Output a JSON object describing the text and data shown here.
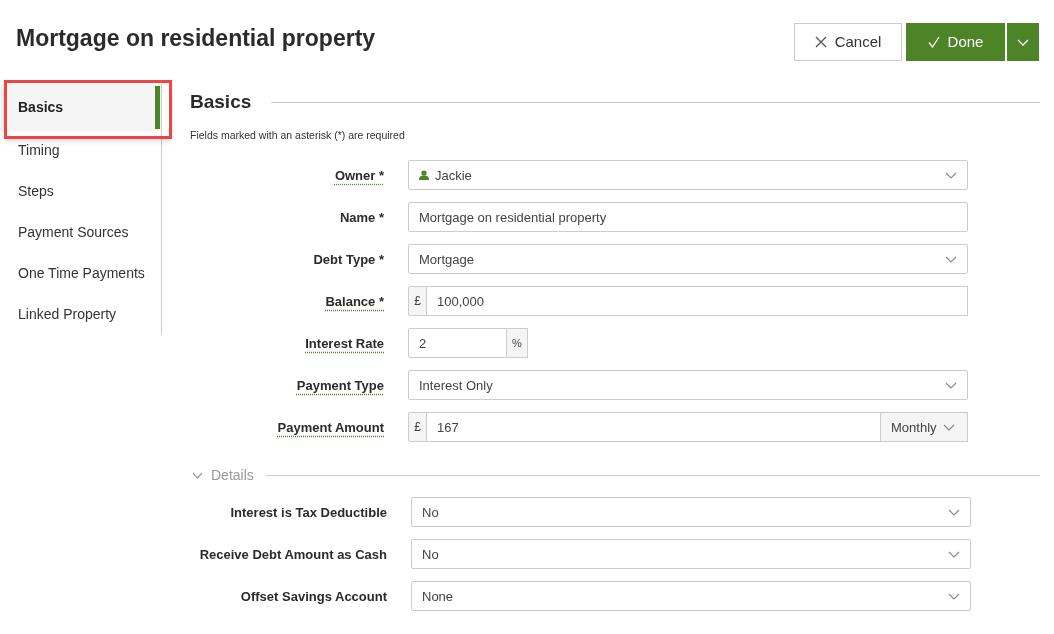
{
  "page_title": "Mortgage on residential property",
  "actions": {
    "cancel": "Cancel",
    "done": "Done"
  },
  "sidebar": {
    "items": [
      {
        "label": "Basics",
        "selected": true
      },
      {
        "label": "Timing",
        "selected": false
      },
      {
        "label": "Steps",
        "selected": false
      },
      {
        "label": "Payment Sources",
        "selected": false
      },
      {
        "label": "One Time Payments",
        "selected": false
      },
      {
        "label": "Linked Property",
        "selected": false
      }
    ]
  },
  "section": {
    "title": "Basics",
    "note": "Fields marked with an asterisk (*) are required"
  },
  "fields": [
    {
      "kind": "select",
      "label": "Owner *",
      "has_help": true,
      "value": "Jackie",
      "person_icon": true
    },
    {
      "kind": "text",
      "label": "Name *",
      "has_help": false,
      "value": "Mortgage on residential property"
    },
    {
      "kind": "select",
      "label": "Debt Type *",
      "has_help": false,
      "value": "Mortgage",
      "person_icon": false
    },
    {
      "kind": "prefix",
      "label": "Balance *",
      "has_help": true,
      "prefix": "£",
      "value": "100,000"
    },
    {
      "kind": "suffix",
      "label": "Interest Rate",
      "has_help": true,
      "suffix": "%",
      "value": "2"
    },
    {
      "kind": "select",
      "label": "Payment Type",
      "has_help": true,
      "value": "Interest Only",
      "person_icon": false
    },
    {
      "kind": "amount-period",
      "label": "Payment Amount",
      "has_help": true,
      "prefix": "£",
      "value": "167",
      "period": "Monthly"
    }
  ],
  "details": {
    "title": "Details",
    "expanded": true,
    "fields": [
      {
        "kind": "select",
        "label": "Interest is Tax Deductible",
        "has_help": false,
        "value": "No",
        "person_icon": false
      },
      {
        "kind": "select",
        "label": "Receive Debt Amount as Cash",
        "has_help": false,
        "value": "No",
        "person_icon": false
      },
      {
        "kind": "select",
        "label": "Offset Savings Account",
        "has_help": false,
        "value": "None",
        "person_icon": false
      }
    ]
  }
}
